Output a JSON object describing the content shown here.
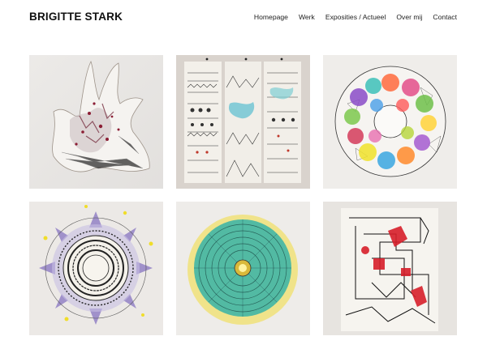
{
  "header": {
    "site_title": "BRIGITTE STARK",
    "nav": [
      "Homepage",
      "Werk",
      "Exposities / Actueel",
      "Over mij",
      "Contact"
    ]
  },
  "gallery": {
    "tiles": [
      {
        "name": "artwork-hand-tile",
        "icon": "artwork-image"
      },
      {
        "name": "artwork-scrolls-tile",
        "icon": "artwork-image"
      },
      {
        "name": "artwork-circle-ring-tile",
        "icon": "artwork-image"
      },
      {
        "name": "artwork-mandala-tile",
        "icon": "artwork-image"
      },
      {
        "name": "artwork-blue-flower-tile",
        "icon": "artwork-image"
      },
      {
        "name": "artwork-abstract-lines-tile",
        "icon": "artwork-image"
      }
    ]
  },
  "colors": {
    "background": "#ffffff",
    "text": "#111111"
  }
}
